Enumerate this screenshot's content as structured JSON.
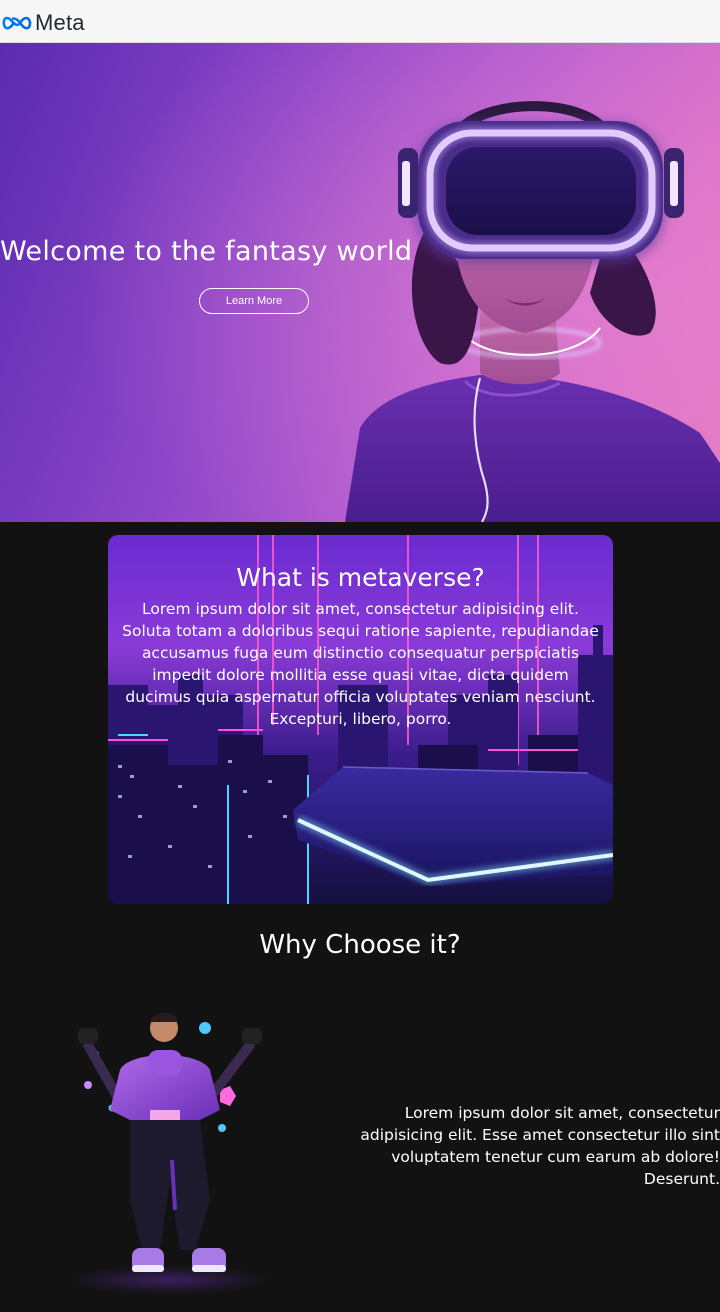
{
  "header": {
    "logo_text": "Meta",
    "brand_color": "#0668E1"
  },
  "hero": {
    "title": "Welcome to the fantasy world",
    "button_label": "Learn More"
  },
  "about": {
    "title": "What is metaverse?",
    "body": "Lorem ipsum dolor sit amet, consectetur adipisicing elit. Soluta totam a doloribus sequi ratione sapiente, repudiandae accusamus fuga eum distinctio consequatur perspiciatis impedit dolore mollitia esse quasi vitae, dicta quidem ducimus quia aspernatur officia voluptates veniam nesciunt. Excepturi, libero, porro."
  },
  "why": {
    "title": "Why Choose it?",
    "body": "Lorem ipsum dolor sit amet, consectetur adipisicing elit. Esse amet consectetur illo sint voluptatem tenetur cum earum ab dolore! Deserunt."
  },
  "colors": {
    "page_background": "#121212",
    "hero_purple": "#8b45c8",
    "neon_glow": "#c9a6ff"
  }
}
